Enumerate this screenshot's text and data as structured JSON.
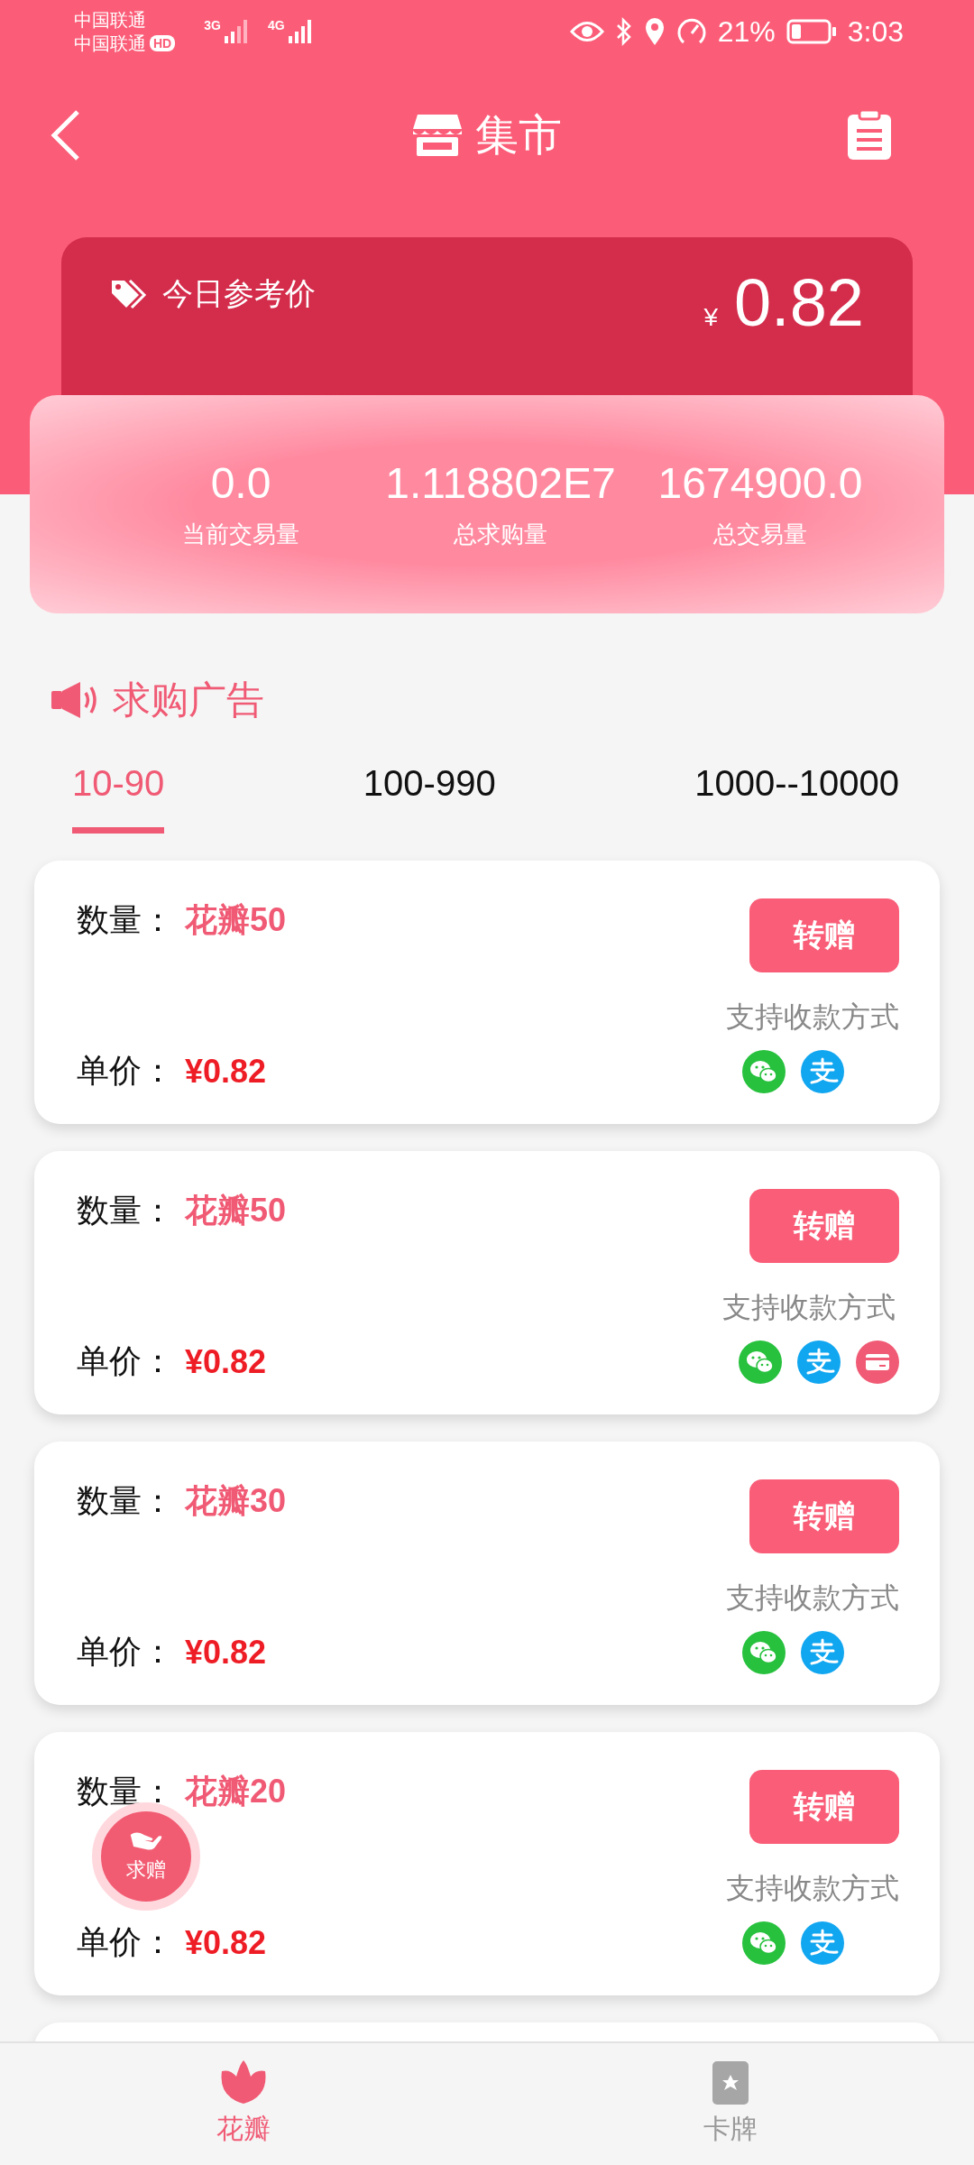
{
  "status_bar": {
    "carriers": [
      "中国联通",
      "中国联通"
    ],
    "hd_badge": "HD",
    "networks": [
      "3G",
      "4G"
    ],
    "battery": "21%",
    "time": "3:03"
  },
  "header": {
    "title": "集市"
  },
  "reference_price": {
    "label": "今日参考价",
    "currency": "¥",
    "value": "0.82"
  },
  "stats": [
    {
      "value": "0.0",
      "label": "当前交易量"
    },
    {
      "value": "1.118802E7",
      "label": "总求购量"
    },
    {
      "value": "1674900.0",
      "label": "总交易量"
    }
  ],
  "section_title": "求购广告",
  "tabs": [
    {
      "label": "10-90",
      "selected": true
    },
    {
      "label": "100-990",
      "selected": false
    },
    {
      "label": "1000--10000",
      "selected": false
    }
  ],
  "listings": [
    {
      "quantity_label": "数量：",
      "quantity": "花瓣50",
      "price_label": "单价：",
      "price": "¥0.82",
      "button": "转赠",
      "payment_label": "支持收款方式",
      "payments": [
        {
          "kind": "wechat"
        },
        {
          "kind": "alipay"
        }
      ]
    },
    {
      "quantity_label": "数量：",
      "quantity": "花瓣50",
      "price_label": "单价：",
      "price": "¥0.82",
      "button": "转赠",
      "payment_label": "支持收款方式",
      "payments": [
        {
          "kind": "wechat"
        },
        {
          "kind": "alipay"
        },
        {
          "kind": "card"
        }
      ]
    },
    {
      "quantity_label": "数量：",
      "quantity": "花瓣30",
      "price_label": "单价：",
      "price": "¥0.82",
      "button": "转赠",
      "payment_label": "支持收款方式",
      "payments": [
        {
          "kind": "wechat"
        },
        {
          "kind": "alipay"
        }
      ]
    },
    {
      "quantity_label": "数量：",
      "quantity": "花瓣20",
      "price_label": "单价：",
      "price": "¥0.82",
      "button": "转赠",
      "payment_label": "支持收款方式",
      "payments": [
        {
          "kind": "wechat"
        },
        {
          "kind": "alipay"
        }
      ]
    }
  ],
  "float_button": {
    "label": "求赠"
  },
  "bottom_nav": [
    {
      "label": "花瓣",
      "kind": "petal",
      "selected": true
    },
    {
      "label": "卡牌",
      "kind": "card",
      "selected": false
    }
  ]
}
